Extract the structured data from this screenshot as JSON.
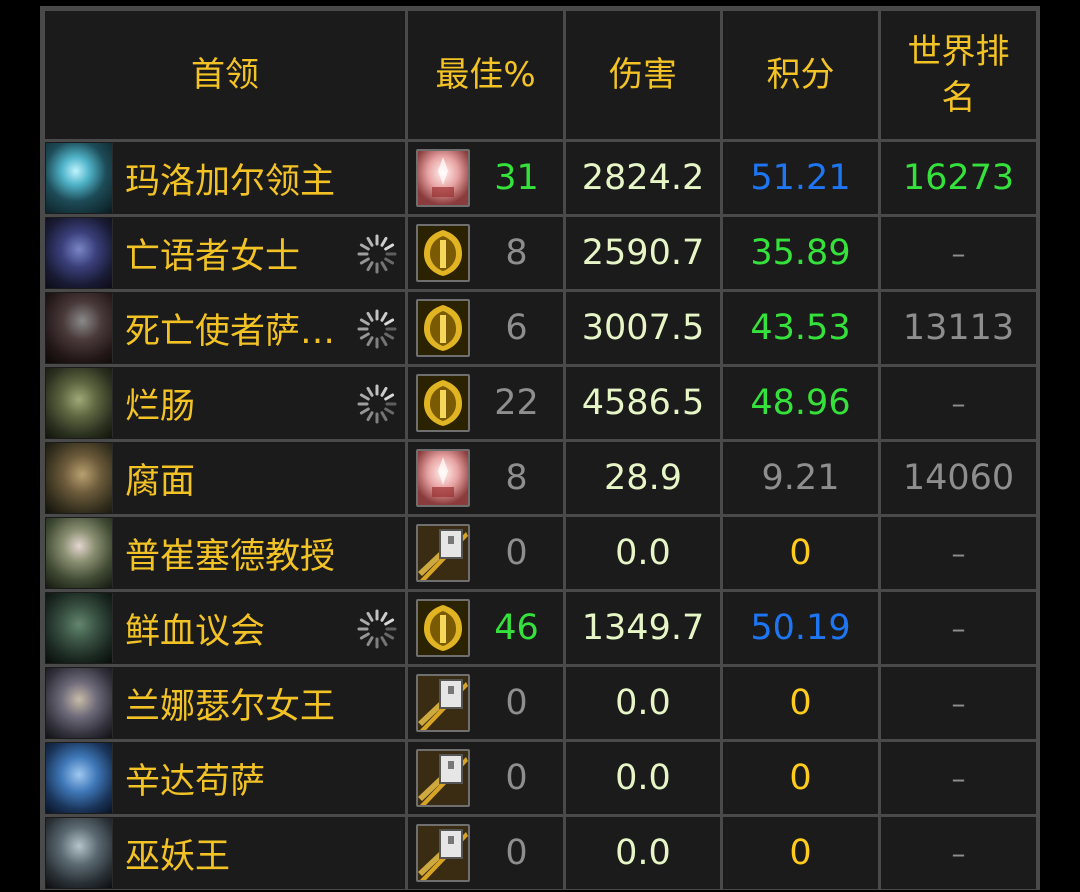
{
  "headers": {
    "boss": "首领",
    "best": "最佳%",
    "damage": "伤害",
    "score": "积分",
    "rank": "世界排名"
  },
  "colors": {
    "gold": "#f3c326",
    "green": "#35e23b",
    "blue": "#1f76f2",
    "grey": "#8e8e8e",
    "orange": "#ffcb1c",
    "damage_text": "#e7f6c6"
  },
  "rows": [
    {
      "boss": "玛洛加尔领主",
      "portrait": "ice-skeleton-portrait",
      "pending": false,
      "spec_icon": "holy-priest-icon",
      "best": "31",
      "best_color": "green",
      "damage": "2824.2",
      "score": "51.21",
      "score_color": "blue",
      "rank": "16273",
      "rank_color": "green"
    },
    {
      "boss": "亡语者女士",
      "portrait": "deathwhisper-portrait",
      "pending": true,
      "spec_icon": "gold-shield-icon",
      "best": "8",
      "best_color": "grey",
      "damage": "2590.7",
      "score": "35.89",
      "score_color": "green",
      "rank": "–",
      "rank_color": "dash"
    },
    {
      "boss": "死亡使者萨…",
      "portrait": "saurfang-portrait",
      "pending": true,
      "spec_icon": "gold-shield-icon",
      "best": "6",
      "best_color": "grey",
      "damage": "3007.5",
      "score": "43.53",
      "score_color": "green",
      "rank": "13113",
      "rank_color": "grey"
    },
    {
      "boss": "烂肠",
      "portrait": "rotface-portrait",
      "pending": true,
      "spec_icon": "gold-shield-icon",
      "best": "22",
      "best_color": "grey",
      "damage": "4586.5",
      "score": "48.96",
      "score_color": "green",
      "rank": "–",
      "rank_color": "dash"
    },
    {
      "boss": "腐面",
      "portrait": "festergut-portrait",
      "pending": false,
      "spec_icon": "holy-priest-icon",
      "best": "8",
      "best_color": "grey",
      "damage": "28.9",
      "score": "9.21",
      "score_color": "grey",
      "rank": "14060",
      "rank_color": "grey"
    },
    {
      "boss": "普崔塞德教授",
      "portrait": "putricide-portrait",
      "pending": false,
      "spec_icon": "hammer-icon",
      "best": "0",
      "best_color": "grey",
      "damage": "0.0",
      "score": "0",
      "score_color": "orange",
      "rank": "–",
      "rank_color": "dash"
    },
    {
      "boss": "鲜血议会",
      "portrait": "blood-council-portrait",
      "pending": true,
      "spec_icon": "gold-shield-icon",
      "best": "46",
      "best_color": "green",
      "damage": "1349.7",
      "score": "50.19",
      "score_color": "blue",
      "rank": "–",
      "rank_color": "dash"
    },
    {
      "boss": "兰娜瑟尔女王",
      "portrait": "lanathel-portrait",
      "pending": false,
      "spec_icon": "hammer-icon",
      "best": "0",
      "best_color": "grey",
      "damage": "0.0",
      "score": "0",
      "score_color": "orange",
      "rank": "–",
      "rank_color": "dash"
    },
    {
      "boss": "辛达苟萨",
      "portrait": "sindragosa-portrait",
      "pending": false,
      "spec_icon": "hammer-icon",
      "best": "0",
      "best_color": "grey",
      "damage": "0.0",
      "score": "0",
      "score_color": "orange",
      "rank": "–",
      "rank_color": "dash"
    },
    {
      "boss": "巫妖王",
      "portrait": "lich-king-portrait",
      "pending": false,
      "spec_icon": "hammer-icon",
      "best": "0",
      "best_color": "grey",
      "damage": "0.0",
      "score": "0",
      "score_color": "orange",
      "rank": "–",
      "rank_color": "dash"
    }
  ]
}
